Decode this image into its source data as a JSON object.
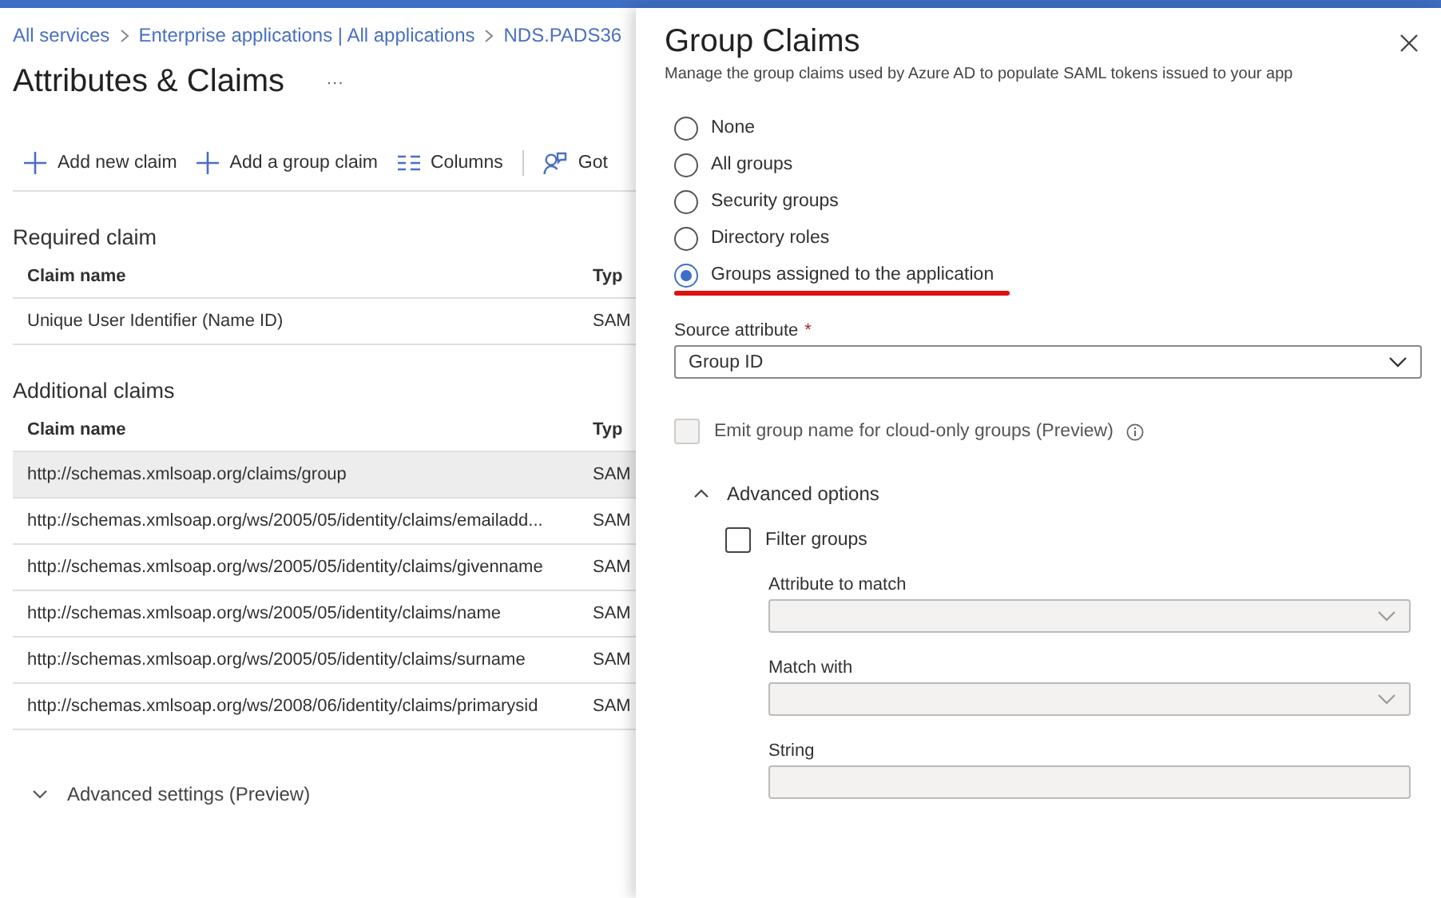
{
  "breadcrumb": [
    "All services",
    "Enterprise applications | All applications",
    "NDS.PADS36"
  ],
  "page_title": "Attributes & Claims",
  "more_label": "···",
  "toolbar": [
    {
      "label": "Add new claim",
      "kind": "plus"
    },
    {
      "label": "Add a group claim",
      "kind": "plus"
    },
    {
      "label": "Columns",
      "kind": "columns"
    },
    {
      "label": "Got",
      "kind": "feedback"
    }
  ],
  "required_claim": {
    "heading": "Required claim",
    "columns": [
      "Claim name",
      "Typ"
    ],
    "rows": [
      {
        "cells": [
          "Unique User Identifier (Name ID)",
          "SAM"
        ],
        "selected": false
      }
    ]
  },
  "additional_claims": {
    "heading": "Additional claims",
    "columns": [
      "Claim name",
      "Typ"
    ],
    "rows": [
      {
        "cells": [
          "http://schemas.xmlsoap.org/claims/group",
          "SAM"
        ],
        "selected": true
      },
      {
        "cells": [
          "http://schemas.xmlsoap.org/ws/2005/05/identity/claims/emailadd...",
          "SAM"
        ],
        "selected": false
      },
      {
        "cells": [
          "http://schemas.xmlsoap.org/ws/2005/05/identity/claims/givenname",
          "SAM"
        ],
        "selected": false
      },
      {
        "cells": [
          "http://schemas.xmlsoap.org/ws/2005/05/identity/claims/name",
          "SAM"
        ],
        "selected": false
      },
      {
        "cells": [
          "http://schemas.xmlsoap.org/ws/2005/05/identity/claims/surname",
          "SAM"
        ],
        "selected": false
      },
      {
        "cells": [
          "http://schemas.xmlsoap.org/ws/2008/06/identity/claims/primarysid",
          "SAM"
        ],
        "selected": false
      }
    ]
  },
  "advanced_settings": {
    "label": "Advanced settings (Preview)",
    "expanded": false
  },
  "panel": {
    "title": "Group Claims",
    "description": "Manage the group claims used by Azure AD to populate SAML tokens issued to your app",
    "options": [
      {
        "label": "None",
        "selected": false,
        "underlined": false
      },
      {
        "label": "All groups",
        "selected": false,
        "underlined": false
      },
      {
        "label": "Security groups",
        "selected": false,
        "underlined": false
      },
      {
        "label": "Directory roles",
        "selected": false,
        "underlined": false
      },
      {
        "label": "Groups assigned to the application",
        "selected": true,
        "underlined": true
      }
    ],
    "source_attribute": {
      "label": "Source attribute",
      "required_mark": "*",
      "value": "Group ID"
    },
    "emit_checkbox": {
      "label": "Emit group name for cloud-only groups (Preview)",
      "checked": false,
      "disabled": true
    },
    "advanced_options": {
      "label": "Advanced options",
      "expanded": true
    },
    "filter_checkbox": {
      "label": "Filter groups",
      "checked": false,
      "disabled": false
    },
    "fields": [
      {
        "label": "Attribute to match",
        "kind": "select",
        "disabled": true
      },
      {
        "label": "Match with",
        "kind": "select",
        "disabled": true
      },
      {
        "label": "String",
        "kind": "text",
        "disabled": true
      }
    ]
  }
}
